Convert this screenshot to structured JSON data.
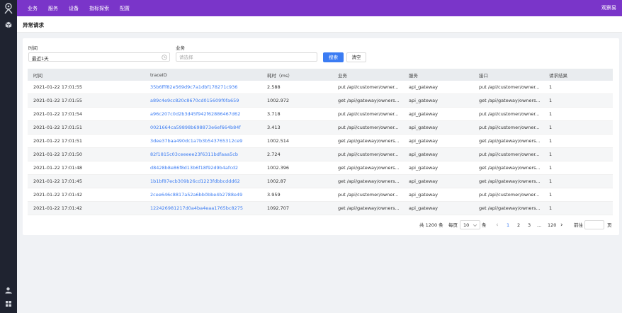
{
  "colors": {
    "topbar": "#7a35c9",
    "sidebar": "#1f2330",
    "primary": "#3b7cf3",
    "link": "#3b7cf3"
  },
  "topnav": {
    "items": [
      "业务",
      "服务",
      "设备",
      "指标探索",
      "配置"
    ],
    "brand": "观察易"
  },
  "sidebar": {
    "icons": [
      "logo-icon",
      "cube-icon",
      "user-icon",
      "grid-icon"
    ]
  },
  "page": {
    "title": "异常请求"
  },
  "filters": {
    "time_label": "时间",
    "time_value": "最近1天",
    "biz_label": "业务",
    "biz_placeholder": "请选择",
    "search_label": "搜索",
    "clear_label": "清空"
  },
  "table": {
    "headers": [
      "时间",
      "traceID",
      "耗时（ms）",
      "业务",
      "服务",
      "接口",
      "请求结果"
    ],
    "rows": [
      [
        "2021-01-22 17:01:55",
        "35b6fff82e569d9c7a1dbf178271c936",
        "2.588",
        "put /api/customer/owner...",
        "api_gateway",
        "put /api/customer/owner...",
        "1"
      ],
      [
        "2021-01-22 17:01:55",
        "a89c4e9cc820c8670cd015609f0fa659",
        "1002.972",
        "get /api/gateway/owners...",
        "api_gateway",
        "get /api/gateway/owners...",
        "1"
      ],
      [
        "2021-01-22 17:01:54",
        "a96c207c0d2b3d45f942f62886467d62",
        "3.718",
        "put /api/customer/owner...",
        "api_gateway",
        "put /api/customer/owner...",
        "1"
      ],
      [
        "2021-01-22 17:01:51",
        "0021664ca59898b698873e6ef664b84f",
        "3.413",
        "put /api/customer/owner...",
        "api_gateway",
        "put /api/customer/owner...",
        "1"
      ],
      [
        "2021-01-22 17:01:51",
        "3dee37baa490dc1a7b3b543765312ce9",
        "1002.514",
        "get /api/gateway/owners...",
        "api_gateway",
        "get /api/gateway/owners...",
        "1"
      ],
      [
        "2021-01-22 17:01:50",
        "82f1815c03ceeeee23f6311bdfaaa5cb",
        "2.724",
        "put /api/customer/owner...",
        "api_gateway",
        "put /api/customer/owner...",
        "1"
      ],
      [
        "2021-01-22 17:01:48",
        "d8428b8e86f8d13b6f18f92d9b4afcd2",
        "1002.396",
        "get /api/gateway/owners...",
        "api_gateway",
        "get /api/gateway/owners...",
        "1"
      ],
      [
        "2021-01-22 17:01:45",
        "1b1bf87ecb309b26cd1223fdbbcddd62",
        "1002.87",
        "get /api/gateway/owners...",
        "api_gateway",
        "get /api/gateway/owners...",
        "1"
      ],
      [
        "2021-01-22 17:01:42",
        "2cee646c8817a52a6bb0bbe4b2788e49",
        "3.959",
        "put /api/customer/owner...",
        "api_gateway",
        "put /api/customer/owner...",
        "1"
      ],
      [
        "2021-01-22 17:01:42",
        "122426981217d0a4ba4eaa1765bc8275",
        "1092.707",
        "get /api/gateway/owners...",
        "api_gateway",
        "get /api/gateway/owners...",
        "1"
      ]
    ]
  },
  "pagination": {
    "total": "共 1200 条",
    "per_page_label": "每页",
    "per_page_value": "10",
    "unit": "条",
    "prev": "‹",
    "pages": [
      "1",
      "2",
      "3",
      "...",
      "120"
    ],
    "next": "›",
    "goto_label": "前往",
    "goto_unit": "页"
  }
}
